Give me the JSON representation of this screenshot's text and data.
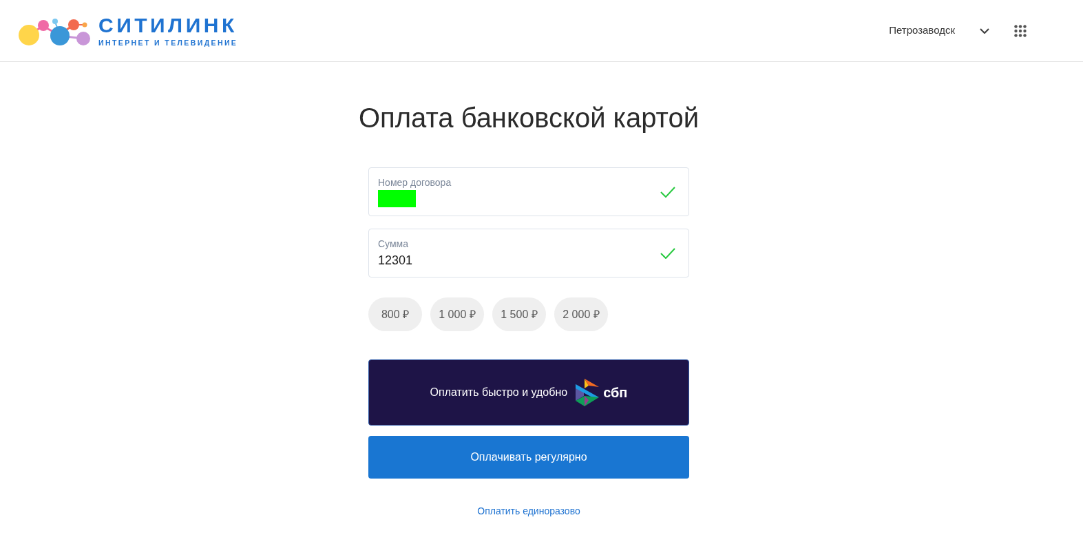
{
  "header": {
    "logo": {
      "name": "СИТИЛИНК",
      "tagline": "ИНТЕРНЕТ И ТЕЛЕВИДЕНИЕ"
    },
    "city": "Петрозаводск"
  },
  "page": {
    "title": "Оплата банковской картой",
    "fields": [
      {
        "label": "Номер договора",
        "redacted": true,
        "valid": true
      },
      {
        "label": "Сумма",
        "value": "12301",
        "redacted": false,
        "valid": true
      }
    ],
    "amount_options": [
      {
        "label": "800 ₽",
        "selected": false
      },
      {
        "label": "1 000 ₽",
        "selected": false
      },
      {
        "label": "1 500 ₽",
        "selected": false
      },
      {
        "label": "2 000 ₽",
        "selected": false
      }
    ],
    "buttons": [
      {
        "kind": "sbp",
        "label": "Оплатить быстро и удобно",
        "logo_text": "сбп"
      },
      {
        "kind": "primary",
        "label": "Оплачивать регулярно"
      }
    ],
    "link": "Оплатить единоразово"
  }
}
